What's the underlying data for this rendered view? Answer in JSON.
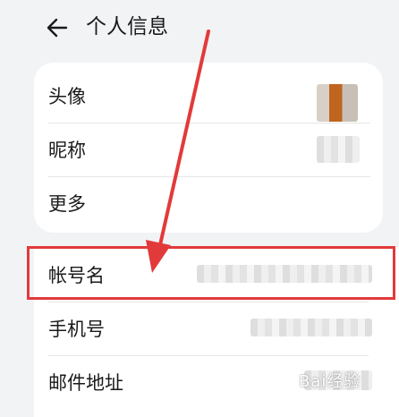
{
  "header": {
    "title": "个人信息",
    "back_icon": "arrow-left-icon"
  },
  "profile_card": {
    "rows": [
      {
        "label": "头像"
      },
      {
        "label": "昵称"
      },
      {
        "label": "更多"
      }
    ]
  },
  "account_section": {
    "rows": [
      {
        "label": "帐号名"
      },
      {
        "label": "手机号"
      },
      {
        "label": "邮件地址"
      }
    ]
  },
  "annotation": {
    "highlight_color": "#e23a3a",
    "arrow_color": "#e23a3a"
  },
  "watermark": {
    "text": "Bai经验"
  }
}
